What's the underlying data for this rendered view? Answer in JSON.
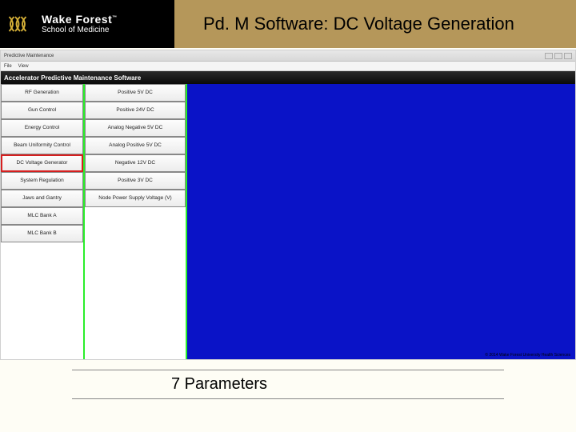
{
  "logo": {
    "line1": "Wake Forest",
    "line2": "School of Medicine",
    "tm": "™"
  },
  "slide_title": "Pd. M Software: DC Voltage Generation",
  "window": {
    "title": "Predictive Maintenance",
    "menu_file": "File",
    "menu_view": "View",
    "app_title": "Accelerator Predictive Maintenance Software"
  },
  "nav_items": [
    "RF Generation",
    "Gun Control",
    "Energy Control",
    "Beam Uniformity Control",
    "DC Voltage Generator",
    "System Regulation",
    "Jaws and Gantry",
    "MLC Bank A",
    "MLC Bank B"
  ],
  "param_items": [
    "Positive 5V DC",
    "Positive 24V DC",
    "Analog Negative 5V DC",
    "Analog Positive 5V DC",
    "Negative 12V DC",
    "Positive 3V DC",
    "Node Power Supply Voltage (V)"
  ],
  "copyright": "© 2014 Wake Forest University Health Sciences",
  "caption": "7 Parameters"
}
